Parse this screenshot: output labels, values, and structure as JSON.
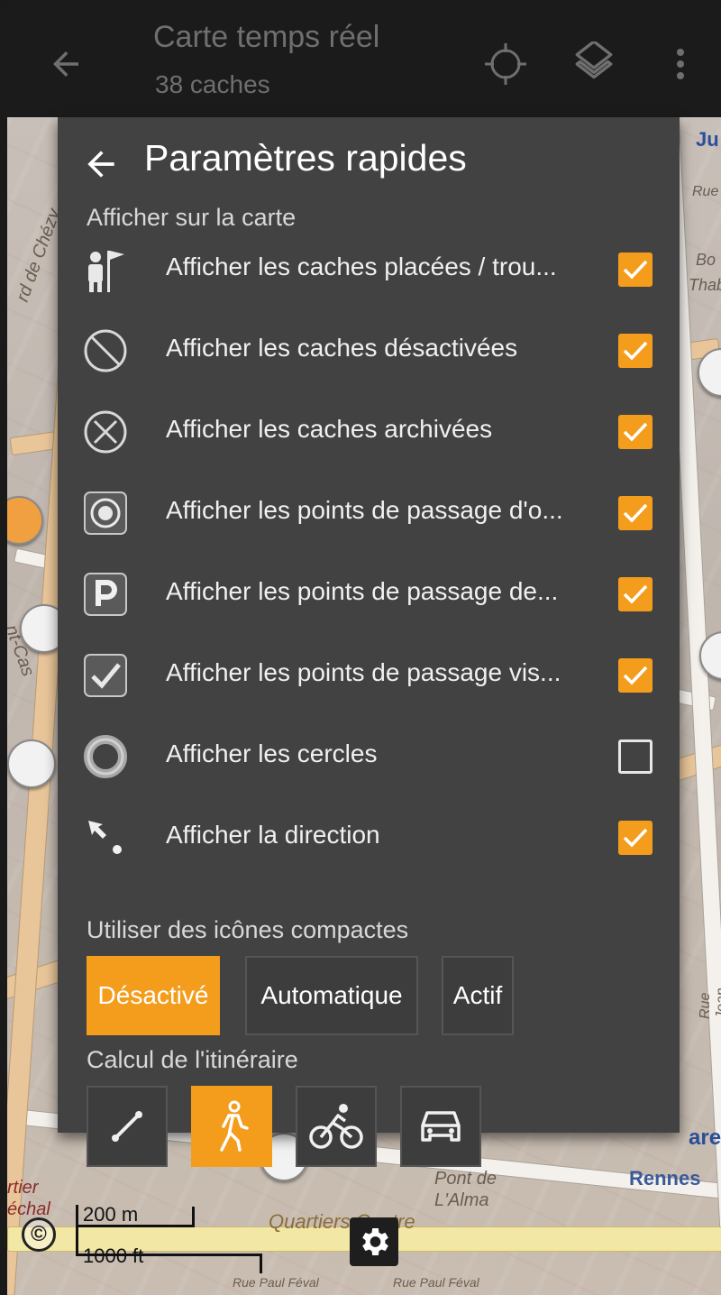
{
  "toolbar": {
    "title": "Carte temps réel",
    "subtitle": "38 caches",
    "back_icon": "arrow-left-icon",
    "icons": [
      "crosshair-icon",
      "layers-icon",
      "more-vert-icon"
    ]
  },
  "sheet": {
    "title": "Paramètres rapides",
    "section_show": "Afficher sur la carte",
    "items": [
      {
        "label": "Afficher les caches placées / trou...",
        "icon": "owned-found-icon",
        "checked": true
      },
      {
        "label": "Afficher les caches désactivées",
        "icon": "disabled-icon",
        "checked": true
      },
      {
        "label": "Afficher les caches archivées",
        "icon": "archived-icon",
        "checked": true
      },
      {
        "label": "Afficher les points de passage d'o...",
        "icon": "waypoint-original-icon",
        "checked": true
      },
      {
        "label": "Afficher les points de passage de...",
        "icon": "parking-icon",
        "checked": true
      },
      {
        "label": "Afficher les points de passage vis...",
        "icon": "visited-check-icon",
        "checked": true
      },
      {
        "label": "Afficher les cercles",
        "icon": "circle-icon",
        "checked": false
      },
      {
        "label": "Afficher la direction",
        "icon": "direction-icon",
        "checked": true
      }
    ],
    "section_compact": "Utiliser des icônes compactes",
    "compact_options": [
      "Désactivé",
      "Automatique",
      "Actif"
    ],
    "compact_selected": "Désactivé",
    "section_routing": "Calcul de l'itinéraire",
    "routing_modes": [
      "straight-line-icon",
      "walk-icon",
      "bike-icon",
      "car-icon"
    ],
    "routing_selected": "walk-icon"
  },
  "map": {
    "labels": [
      "Ju",
      "Rue",
      "Bo",
      "Thab",
      "rd de Chézy",
      "nt-Cas",
      "Quartiers Centre",
      "Pont de",
      "L'Alma",
      "Rennes",
      "ares",
      "Rue Jean-Marie Duhamel",
      "rtier",
      "échal",
      "Rue Paul Féval",
      "Rue Paul Féval"
    ],
    "scale_metric": "200 m",
    "scale_imperial": "1000 ft",
    "copyright_symbol": "©",
    "settings_icon": "gear-icon"
  },
  "colors": {
    "accent": "#f49d1d",
    "sheet_bg": "#424242",
    "toolbar_bg": "#1b1b1b"
  }
}
